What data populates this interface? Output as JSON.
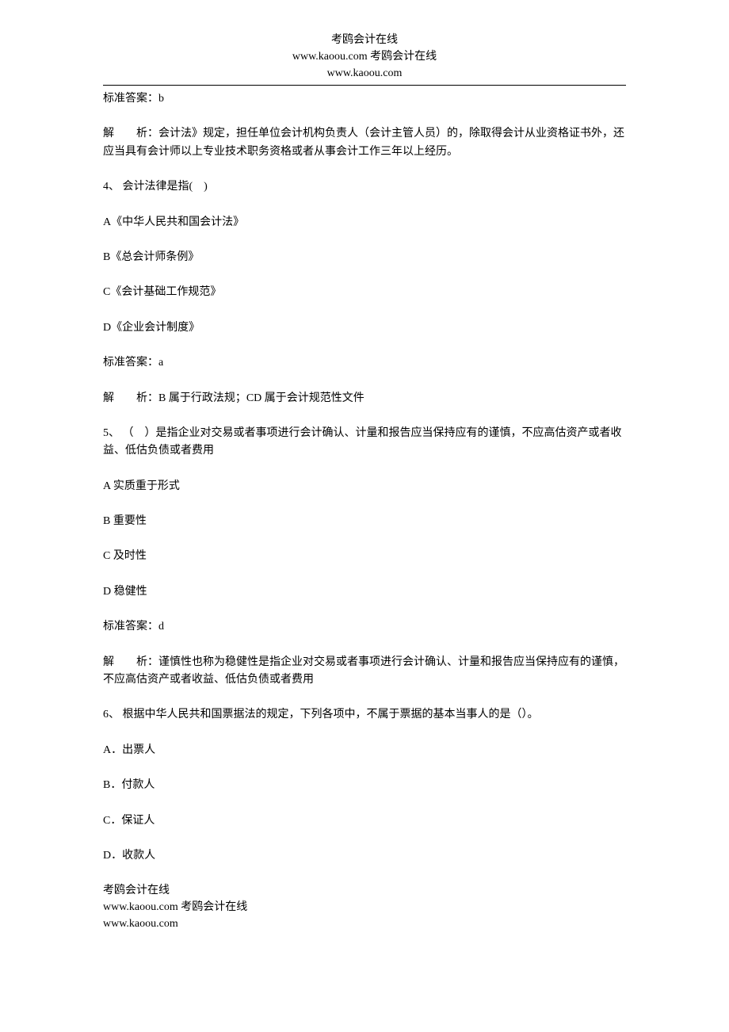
{
  "header": {
    "line1": "考鸥会计在线",
    "line2": "www.kaoou.com 考鸥会计在线",
    "line3": "www.kaoou.com"
  },
  "q3": {
    "answer": "标准答案：b",
    "analysis": "解　　析：会计法》规定，担任单位会计机构负责人（会计主管人员）的，除取得会计从业资格证书外，还应当具有会计师以上专业技术职务资格或者从事会计工作三年以上经历。"
  },
  "q4": {
    "stem": "4、 会计法律是指(　)",
    "optA": "A《中华人民共和国会计法》",
    "optB": "B《总会计师条例》",
    "optC": "C《会计基础工作规范》",
    "optD": "D《企业会计制度》",
    "answer": "标准答案：a",
    "analysis": "解　　析：B 属于行政法规；CD 属于会计规范性文件"
  },
  "q5": {
    "stem": "5、 （　）是指企业对交易或者事项进行会计确认、计量和报告应当保持应有的谨慎，不应高估资产或者收益、低估负债或者费用",
    "optA": "A 实质重于形式",
    "optB": "B 重要性",
    "optC": "C 及时性",
    "optD": "D 稳健性",
    "answer": "标准答案：d",
    "analysis": "解　　析：谨慎性也称为稳健性是指企业对交易或者事项进行会计确认、计量和报告应当保持应有的谨慎，不应高估资产或者收益、低估负债或者费用"
  },
  "q6": {
    "stem": "6、 根据中华人民共和国票据法的规定，下列各项中，不属于票据的基本当事人的是（）。",
    "optA": "A．出票人",
    "optB": "B．付款人",
    "optC": "C．保证人",
    "optD": "D．收款人"
  },
  "footer": {
    "line1": "考鸥会计在线",
    "line2": "www.kaoou.com 考鸥会计在线",
    "line3": "www.kaoou.com"
  }
}
